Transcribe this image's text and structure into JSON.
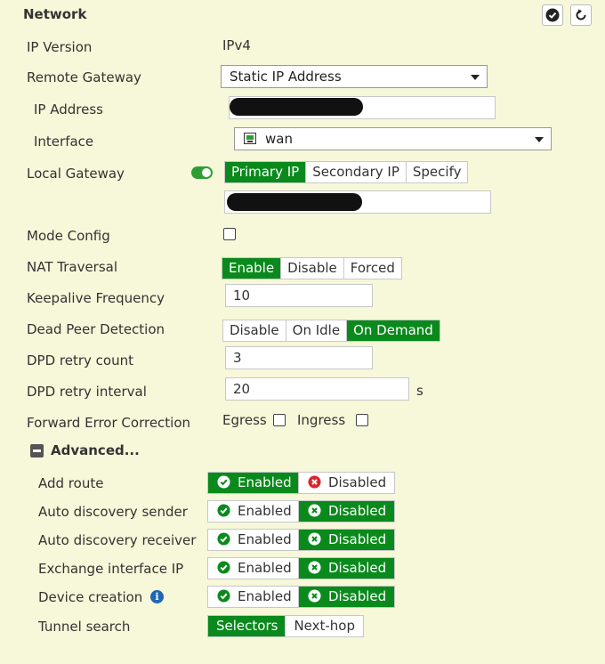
{
  "section_title": "Network",
  "labels": {
    "ip_version": "IP Version",
    "remote_gateway": "Remote Gateway",
    "ip_address": "IP Address",
    "interface": "Interface",
    "local_gateway": "Local Gateway",
    "mode_config": "Mode Config",
    "nat_traversal": "NAT Traversal",
    "keepalive": "Keepalive Frequency",
    "dpd": "Dead Peer Detection",
    "dpd_retry_count": "DPD retry count",
    "dpd_retry_interval": "DPD retry interval",
    "fec": "Forward Error Correction",
    "advanced": "Advanced...",
    "add_route": "Add route",
    "ad_sender": "Auto discovery sender",
    "ad_receiver": "Auto discovery receiver",
    "exchange_ip": "Exchange interface IP",
    "device_creation": "Device creation",
    "tunnel_search": "Tunnel search"
  },
  "values": {
    "ip_version": "IPv4",
    "remote_gateway": "Static IP Address",
    "interface": "wan",
    "keepalive": "10",
    "dpd_retry_count": "3",
    "dpd_retry_interval": "20",
    "dpd_retry_interval_unit": "s",
    "fec_egress": "Egress",
    "fec_ingress": "Ingress"
  },
  "local_gateway_options": [
    "Primary IP",
    "Secondary IP",
    "Specify"
  ],
  "nat_options": [
    "Enable",
    "Disable",
    "Forced"
  ],
  "dpd_options": [
    "Disable",
    "On Idle",
    "On Demand"
  ],
  "toggle_labels": {
    "enabled": "Enabled",
    "disabled": "Disabled"
  },
  "tunnel_search_options": [
    "Selectors",
    "Next-hop"
  ],
  "colors": {
    "accent_green": "#0a8a1c",
    "background": "#f7f7d9",
    "error_red": "#d9262c",
    "info_blue": "#1f66b3"
  },
  "icons": [
    "check-circle-icon",
    "refresh-icon",
    "chevron-down-icon",
    "network-interface-icon",
    "x-circle-icon",
    "info-icon",
    "collapse-minus-icon"
  ]
}
